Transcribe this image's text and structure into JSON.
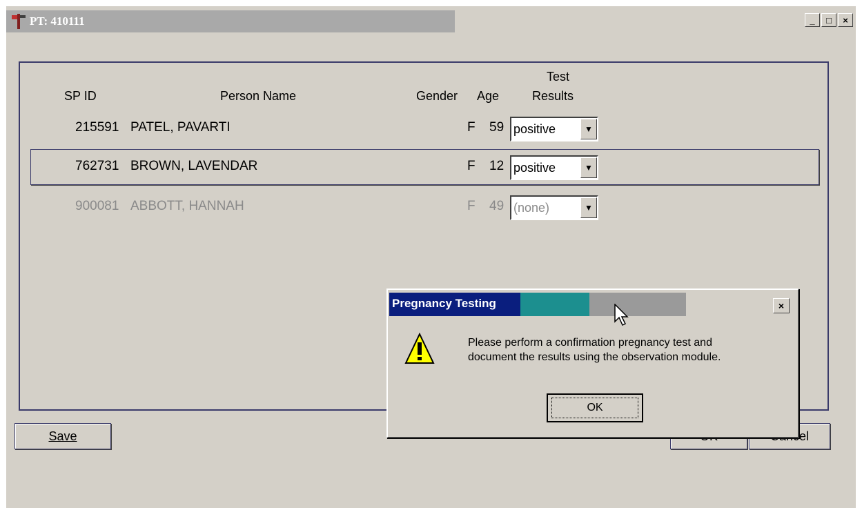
{
  "window": {
    "title": "PT: 410111",
    "buttons": [
      "_",
      "□",
      "×"
    ]
  },
  "table": {
    "headers": {
      "sp_id": "SP ID",
      "person_name": "Person Name",
      "gender": "Gender",
      "age": "Age",
      "test_line1": "Test",
      "test_line2": "Results"
    },
    "rows": [
      {
        "sp_id": "215591",
        "name": "PATEL, PAVARTI",
        "gender": "F",
        "age": "59",
        "result": "positive",
        "enabled": true,
        "selected": false
      },
      {
        "sp_id": "762731",
        "name": "BROWN, LAVENDAR",
        "gender": "F",
        "age": "12",
        "result": "positive",
        "enabled": true,
        "selected": true
      },
      {
        "sp_id": "900081",
        "name": "ABBOTT, HANNAH",
        "gender": "F",
        "age": "49",
        "result": "(none)",
        "enabled": false,
        "selected": false
      }
    ]
  },
  "buttons": {
    "save": "Save",
    "ok": "OK",
    "cancel": "Cancel"
  },
  "dialog": {
    "title": "Pregnancy Testing",
    "close": "×",
    "message_line1": "Please perform a confirmation pregnancy test and",
    "message_line2": "document the results using the observation module.",
    "ok": "OK",
    "icon": "warning-icon"
  }
}
